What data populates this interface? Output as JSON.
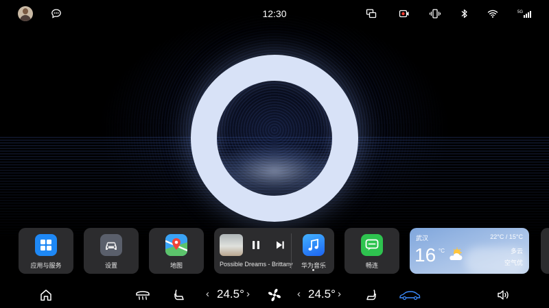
{
  "status_bar": {
    "time": "12:30",
    "signal_label": "5G"
  },
  "dock": {
    "apps": [
      {
        "label": "应用与服务",
        "icon": "apps-grid-icon",
        "color": "#1e88f5"
      },
      {
        "label": "设置",
        "icon": "car-settings-icon",
        "color": "#5a5f6b"
      },
      {
        "label": "地图",
        "icon": "map-icon",
        "color": "#3aa3f5"
      }
    ],
    "music": {
      "title": "Possible Dreams - Brittany",
      "app_label": "华为音乐",
      "state": "playing"
    },
    "connect": {
      "label": "畅连",
      "icon": "meetime-icon",
      "color": "#2ec34f"
    },
    "weather": {
      "city": "武汉",
      "range": "22°C / 15°C",
      "temp": "16",
      "unit": "°C",
      "condition": "多云",
      "air": "空气优"
    }
  },
  "bottom_bar": {
    "driver_temp": "24.5°",
    "passenger_temp": "24.5°"
  }
}
